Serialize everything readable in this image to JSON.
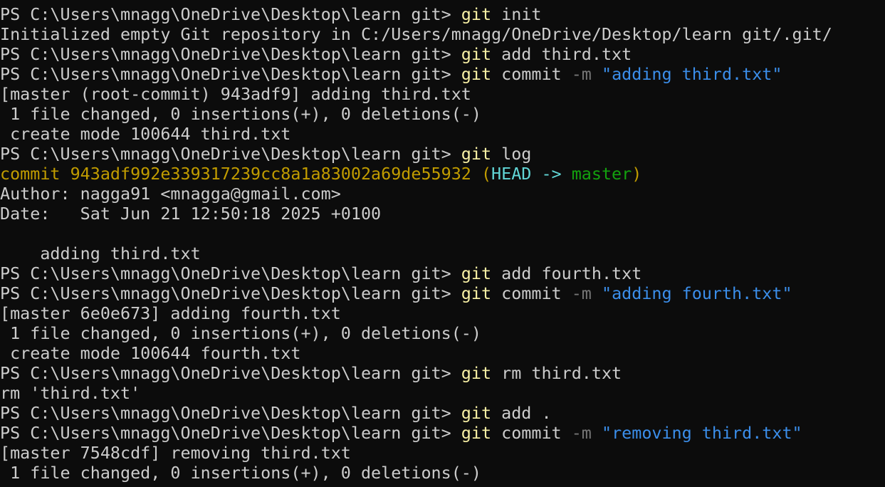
{
  "terminal": {
    "background": "#0c0c0c",
    "colors": {
      "default": "#cccccc",
      "command": "#f9f1a5",
      "flag": "#767676",
      "string": "#3b8eea",
      "commit_hash": "#c19c00",
      "head": "#61d6d6",
      "branch": "#13a10e"
    },
    "lines": [
      [
        {
          "t": "PS C:\\Users\\mnagg\\OneDrive\\Desktop\\learn git> ",
          "c": "plain"
        },
        {
          "t": "git",
          "c": "cmd"
        },
        {
          "t": " init",
          "c": "plain"
        }
      ],
      [
        {
          "t": "Initialized empty Git repository in C:/Users/mnagg/OneDrive/Desktop/learn git/.git/",
          "c": "plain"
        }
      ],
      [
        {
          "t": "PS C:\\Users\\mnagg\\OneDrive\\Desktop\\learn git> ",
          "c": "plain"
        },
        {
          "t": "git",
          "c": "cmd"
        },
        {
          "t": " add third.txt",
          "c": "plain"
        }
      ],
      [
        {
          "t": "PS C:\\Users\\mnagg\\OneDrive\\Desktop\\learn git> ",
          "c": "plain"
        },
        {
          "t": "git",
          "c": "cmd"
        },
        {
          "t": " commit ",
          "c": "plain"
        },
        {
          "t": "-m",
          "c": "flag"
        },
        {
          "t": " ",
          "c": "plain"
        },
        {
          "t": "\"adding third.txt\"",
          "c": "str"
        }
      ],
      [
        {
          "t": "[master (root-commit) 943adf9] adding third.txt",
          "c": "plain"
        }
      ],
      [
        {
          "t": " 1 file changed, 0 insertions(+), 0 deletions(-)",
          "c": "plain"
        }
      ],
      [
        {
          "t": " create mode 100644 third.txt",
          "c": "plain"
        }
      ],
      [
        {
          "t": "PS C:\\Users\\mnagg\\OneDrive\\Desktop\\learn git> ",
          "c": "plain"
        },
        {
          "t": "git",
          "c": "cmd"
        },
        {
          "t": " log",
          "c": "plain"
        }
      ],
      [
        {
          "t": "commit 943adf992e339317239cc8a1a83002a69de55932 (",
          "c": "hash"
        },
        {
          "t": "HEAD -> ",
          "c": "head"
        },
        {
          "t": "master",
          "c": "branch"
        },
        {
          "t": ")",
          "c": "hash"
        }
      ],
      [
        {
          "t": "Author: nagga91 <mnagga@gmail.com>",
          "c": "plain"
        }
      ],
      [
        {
          "t": "Date:   Sat Jun 21 12:50:18 2025 +0100",
          "c": "plain"
        }
      ],
      [
        {
          "t": "",
          "c": "plain"
        }
      ],
      [
        {
          "t": "    adding third.txt",
          "c": "plain"
        }
      ],
      [
        {
          "t": "PS C:\\Users\\mnagg\\OneDrive\\Desktop\\learn git> ",
          "c": "plain"
        },
        {
          "t": "git",
          "c": "cmd"
        },
        {
          "t": " add fourth.txt",
          "c": "plain"
        }
      ],
      [
        {
          "t": "PS C:\\Users\\mnagg\\OneDrive\\Desktop\\learn git> ",
          "c": "plain"
        },
        {
          "t": "git",
          "c": "cmd"
        },
        {
          "t": " commit ",
          "c": "plain"
        },
        {
          "t": "-m",
          "c": "flag"
        },
        {
          "t": " ",
          "c": "plain"
        },
        {
          "t": "\"adding fourth.txt\"",
          "c": "str"
        }
      ],
      [
        {
          "t": "[master 6e0e673] adding fourth.txt",
          "c": "plain"
        }
      ],
      [
        {
          "t": " 1 file changed, 0 insertions(+), 0 deletions(-)",
          "c": "plain"
        }
      ],
      [
        {
          "t": " create mode 100644 fourth.txt",
          "c": "plain"
        }
      ],
      [
        {
          "t": "PS C:\\Users\\mnagg\\OneDrive\\Desktop\\learn git> ",
          "c": "plain"
        },
        {
          "t": "git",
          "c": "cmd"
        },
        {
          "t": " rm third.txt",
          "c": "plain"
        }
      ],
      [
        {
          "t": "rm 'third.txt'",
          "c": "plain"
        }
      ],
      [
        {
          "t": "PS C:\\Users\\mnagg\\OneDrive\\Desktop\\learn git> ",
          "c": "plain"
        },
        {
          "t": "git",
          "c": "cmd"
        },
        {
          "t": " add .",
          "c": "plain"
        }
      ],
      [
        {
          "t": "PS C:\\Users\\mnagg\\OneDrive\\Desktop\\learn git> ",
          "c": "plain"
        },
        {
          "t": "git",
          "c": "cmd"
        },
        {
          "t": " commit ",
          "c": "plain"
        },
        {
          "t": "-m",
          "c": "flag"
        },
        {
          "t": " ",
          "c": "plain"
        },
        {
          "t": "\"removing third.txt\"",
          "c": "str"
        }
      ],
      [
        {
          "t": "[master 7548cdf] removing third.txt",
          "c": "plain"
        }
      ],
      [
        {
          "t": " 1 file changed, 0 insertions(+), 0 deletions(-)",
          "c": "plain"
        }
      ]
    ]
  }
}
